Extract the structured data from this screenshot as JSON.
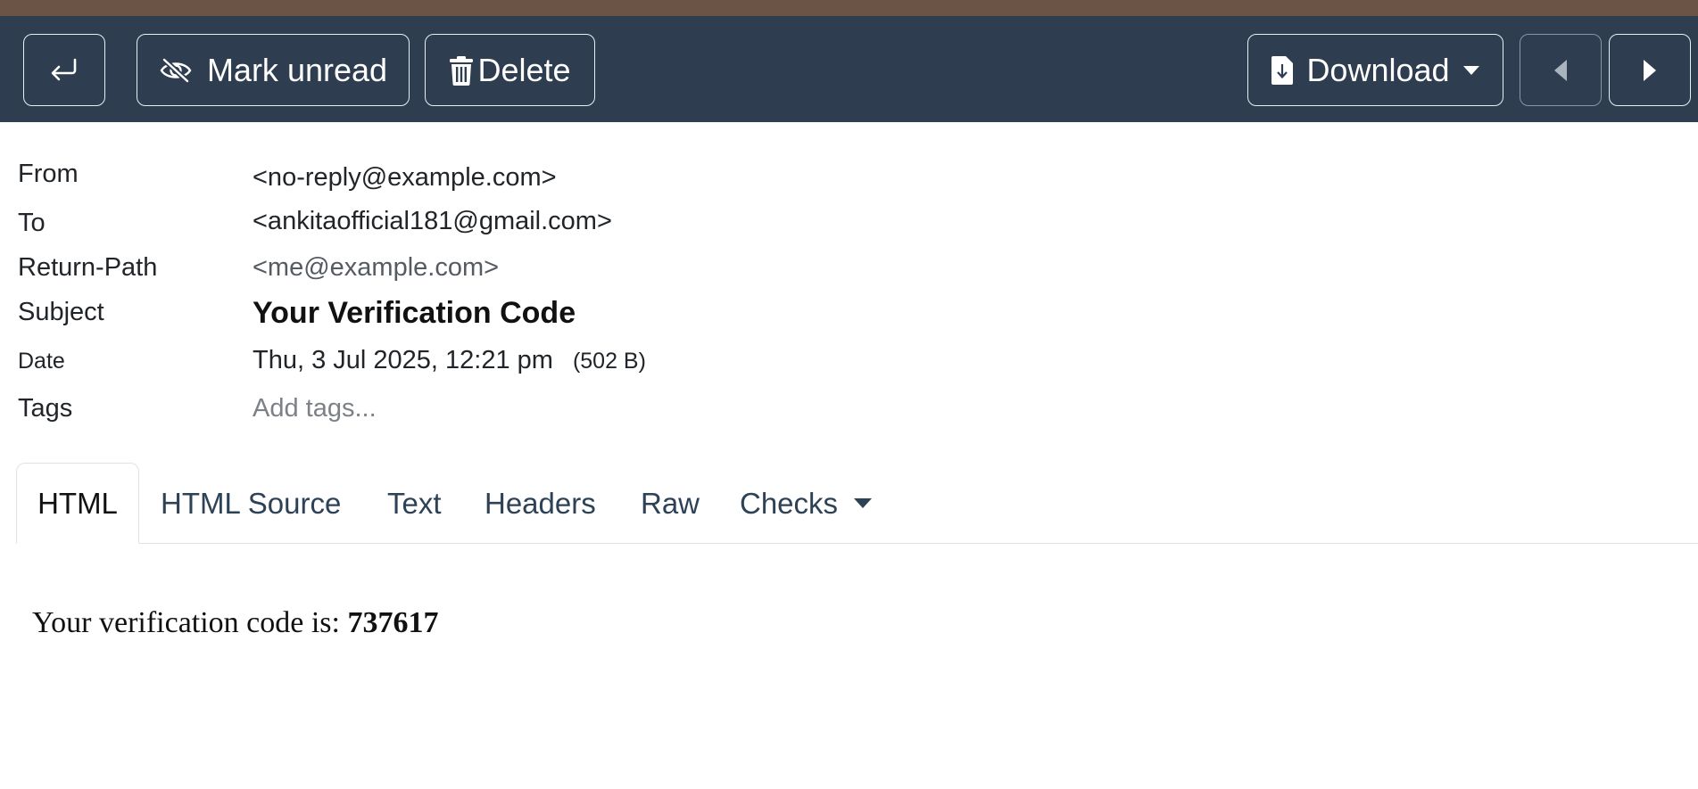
{
  "colors": {
    "toolbar_bg": "#2e3e50",
    "top_strip": "#6b5446",
    "tab_text": "#2e4257"
  },
  "toolbar": {
    "back_icon": "return-arrow-icon",
    "mark_unread_label": "Mark unread",
    "mark_unread_icon": "eye-slash-icon",
    "delete_label": "Delete",
    "delete_icon": "trash-icon",
    "download_label": "Download",
    "download_icon": "file-download-icon",
    "prev_icon": "caret-left-icon",
    "next_icon": "caret-right-icon"
  },
  "headers": {
    "from_label": "From",
    "from_value": "<no-reply@example.com>",
    "to_label": "To",
    "to_value": "<ankitaofficial181@gmail.com>",
    "return_path_label": "Return-Path",
    "return_path_value": "<me@example.com>",
    "subject_label": "Subject",
    "subject_value": "Your Verification Code",
    "date_label": "Date",
    "date_value": "Thu, 3 Jul 2025, 12:21 pm",
    "size_value": "(502 B)",
    "tags_label": "Tags",
    "tags_placeholder": "Add tags..."
  },
  "tabs": [
    {
      "label": "HTML",
      "active": true
    },
    {
      "label": "HTML Source"
    },
    {
      "label": "Text"
    },
    {
      "label": "Headers"
    },
    {
      "label": "Raw"
    },
    {
      "label": "Checks"
    }
  ],
  "message": {
    "text": "Your verification code is:",
    "code": "737617"
  }
}
